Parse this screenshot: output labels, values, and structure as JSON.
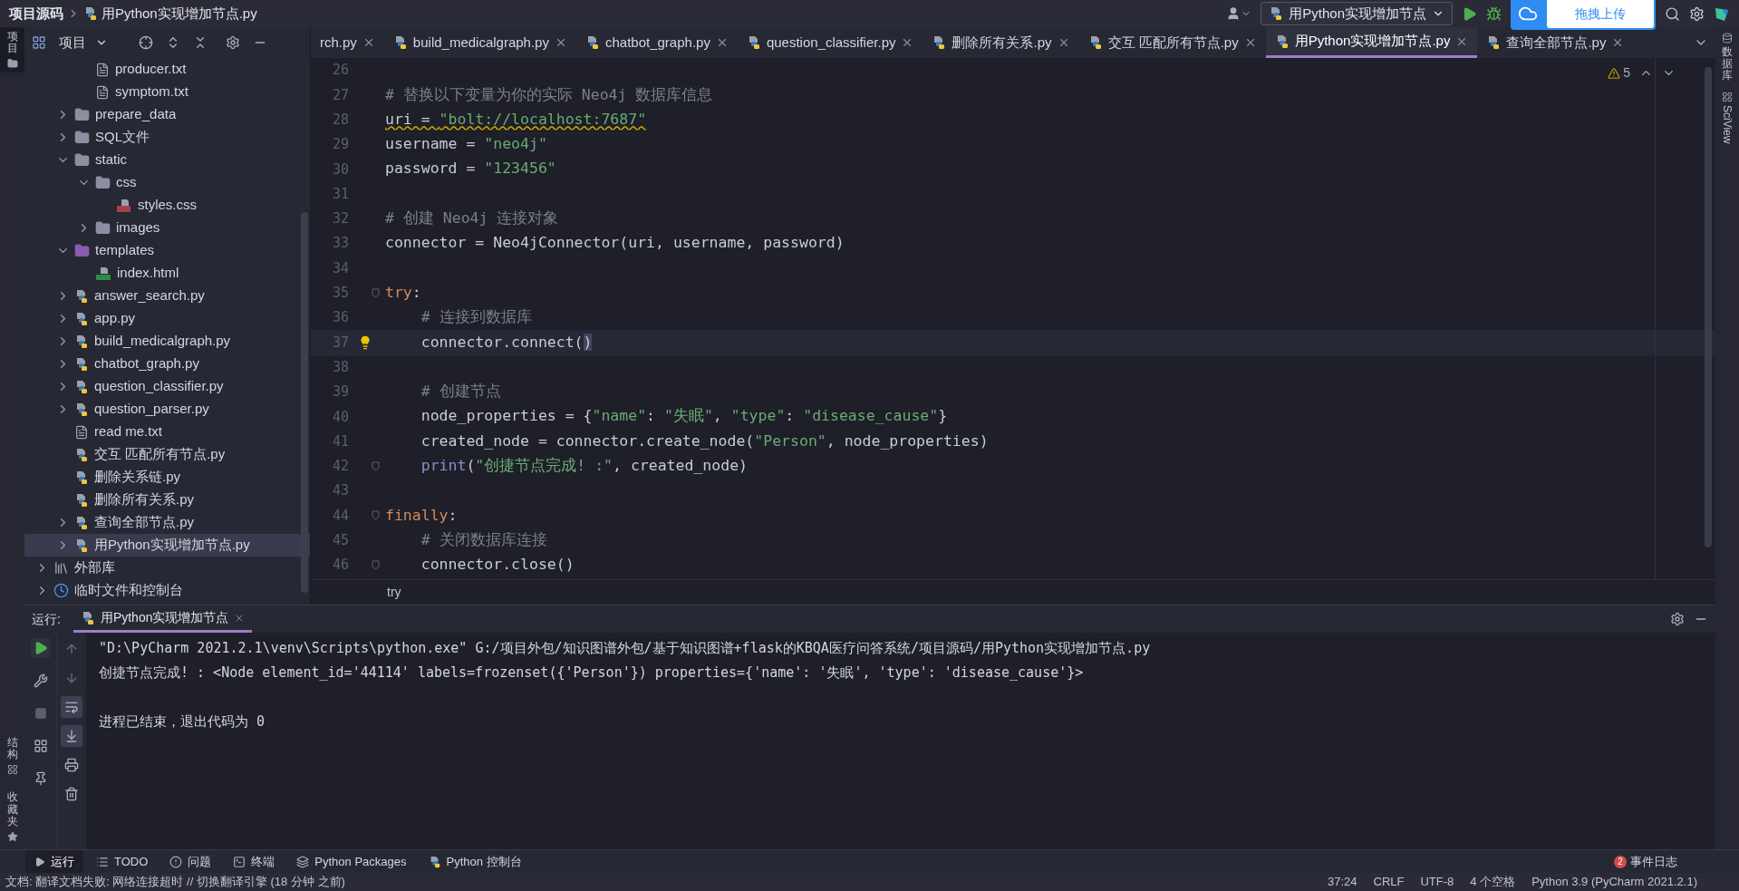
{
  "title_bar": {
    "breadcrumbs": [
      "项目源码",
      "用Python实现增加节点.py"
    ],
    "run_config": "用Python实现增加节点",
    "upload_popup": "拖拽上传"
  },
  "left_stripe": {
    "top": "项目",
    "bottom": [
      "结构",
      "收藏夹"
    ]
  },
  "right_stripe": {
    "items": [
      "数据库",
      "SciView"
    ]
  },
  "project_panel": {
    "title": "项目"
  },
  "tree": {
    "items": [
      {
        "children": [
          {
            "children": [
              {
                "label": "producer.txt",
                "kind": "text",
                "selected": false
              },
              {
                "label": "symptom.txt",
                "kind": "text",
                "selected": false
              }
            ]
          },
          {
            "label": "prepare_data",
            "kind": "folder",
            "expanded": false,
            "selected": false
          },
          {
            "label": "SQL文件",
            "kind": "folder",
            "expanded": false,
            "selected": false
          },
          {
            "label": "static",
            "kind": "folder",
            "expanded": true,
            "selected": false,
            "children": [
              {
                "label": "css",
                "kind": "folder",
                "expanded": true,
                "selected": false,
                "children": [
                  {
                    "label": "styles.css",
                    "kind": "css",
                    "selected": false
                  }
                ]
              },
              {
                "label": "images",
                "kind": "folder",
                "expanded": false,
                "selected": false
              }
            ]
          },
          {
            "label": "templates",
            "kind": "template_folder",
            "expanded": true,
            "selected": false,
            "children": [
              {
                "label": "index.html",
                "kind": "html",
                "selected": false
              }
            ]
          },
          {
            "label": "answer_search.py",
            "kind": "python",
            "expanded": false,
            "selected": false
          },
          {
            "label": "app.py",
            "kind": "python",
            "expanded": false,
            "selected": false
          },
          {
            "label": "build_medicalgraph.py",
            "kind": "python",
            "expanded": false,
            "selected": false
          },
          {
            "label": "chatbot_graph.py",
            "kind": "python",
            "expanded": false,
            "selected": false
          },
          {
            "label": "question_classifier.py",
            "kind": "python",
            "expanded": false,
            "selected": false
          },
          {
            "label": "question_parser.py",
            "kind": "python",
            "expanded": false,
            "selected": false
          },
          {
            "label": "read me.txt",
            "kind": "text",
            "selected": false
          },
          {
            "label": "交互 匹配所有节点.py",
            "kind": "python",
            "selected": false
          },
          {
            "label": "删除关系链.py",
            "kind": "python",
            "selected": false
          },
          {
            "label": "删除所有关系.py",
            "kind": "python",
            "selected": false
          },
          {
            "label": "查询全部节点.py",
            "kind": "python",
            "expanded": false,
            "selected": false
          },
          {
            "label": "用Python实现增加节点.py",
            "kind": "python",
            "expanded": false,
            "selected": true
          }
        ]
      },
      {
        "label": "外部库",
        "kind": "library",
        "expanded": false,
        "selected": false
      },
      {
        "label": "临时文件和控制台",
        "kind": "scratch",
        "expanded": false,
        "selected": false
      }
    ]
  },
  "tabs": [
    {
      "label": "rch.py",
      "selected": false
    },
    {
      "label": "build_medicalgraph.py",
      "selected": false
    },
    {
      "label": "chatbot_graph.py",
      "selected": false
    },
    {
      "label": "question_classifier.py",
      "selected": false
    },
    {
      "label": "删除所有关系.py",
      "selected": false
    },
    {
      "label": "交互 匹配所有节点.py",
      "selected": false
    },
    {
      "label": "用Python实现增加节点.py",
      "selected": true
    },
    {
      "label": "查询全部节点.py",
      "selected": false
    }
  ],
  "editor": {
    "warnings": "5",
    "breadcrumb": "try",
    "lines": [
      {
        "number": "26"
      },
      {
        "number": "27",
        "segments": [
          {
            "t": "# 替换以下变量为你的实际 Neo4j 数据库信息",
            "kind": "comment"
          }
        ]
      },
      {
        "number": "28",
        "segments": [
          {
            "t": "uri = ",
            "kind": "plain",
            "warn": true
          },
          {
            "t": "\"bolt://localhost:7687\"",
            "kind": "string",
            "warn": true
          }
        ]
      },
      {
        "number": "29",
        "segments": [
          {
            "t": "username = ",
            "kind": "plain"
          },
          {
            "t": "\"neo4j\"",
            "kind": "string"
          }
        ]
      },
      {
        "number": "30",
        "segments": [
          {
            "t": "password = ",
            "kind": "plain"
          },
          {
            "t": "\"123456\"",
            "kind": "string"
          }
        ]
      },
      {
        "number": "31"
      },
      {
        "number": "32",
        "segments": [
          {
            "t": "# 创建 Neo4j 连接对象",
            "kind": "comment"
          }
        ]
      },
      {
        "number": "33",
        "segments": [
          {
            "t": "connector = Neo4jConnector(uri, username, password)",
            "kind": "plain"
          }
        ]
      },
      {
        "number": "34"
      },
      {
        "number": "35",
        "fold": true,
        "segments": [
          {
            "t": "try",
            "kind": "keyword"
          },
          {
            "t": ":",
            "kind": "plain"
          }
        ]
      },
      {
        "number": "36",
        "segments": [
          {
            "t": "    # 连接到数据库",
            "kind": "comment"
          }
        ]
      },
      {
        "number": "37",
        "current": true,
        "bulb": true,
        "segments": [
          {
            "t": "    connector.connect(",
            "kind": "plain"
          },
          {
            "t": ")",
            "kind": "match"
          }
        ]
      },
      {
        "number": "38"
      },
      {
        "number": "39",
        "segments": [
          {
            "t": "    # 创建节点",
            "kind": "comment"
          }
        ]
      },
      {
        "number": "40",
        "segments": [
          {
            "t": "    node_properties = {",
            "kind": "plain"
          },
          {
            "t": "\"name\"",
            "kind": "string"
          },
          {
            "t": ": ",
            "kind": "plain"
          },
          {
            "t": "\"失眠\"",
            "kind": "string"
          },
          {
            "t": ", ",
            "kind": "plain"
          },
          {
            "t": "\"type\"",
            "kind": "string"
          },
          {
            "t": ": ",
            "kind": "plain"
          },
          {
            "t": "\"disease_cause\"",
            "kind": "string"
          },
          {
            "t": "}",
            "kind": "plain"
          }
        ]
      },
      {
        "number": "41",
        "segments": [
          {
            "t": "    created_node = connector.create_node(",
            "kind": "plain"
          },
          {
            "t": "\"Person\"",
            "kind": "string"
          },
          {
            "t": ", node_properties)",
            "kind": "plain"
          }
        ]
      },
      {
        "number": "42",
        "fold": true,
        "segments": [
          {
            "t": "    print",
            "kind": "builtin"
          },
          {
            "t": "(",
            "kind": "plain"
          },
          {
            "t": "\"创捷节点完成! :\"",
            "kind": "string"
          },
          {
            "t": ", created_node)",
            "kind": "plain"
          }
        ]
      },
      {
        "number": "43"
      },
      {
        "number": "44",
        "fold": true,
        "segments": [
          {
            "t": "finally",
            "kind": "keyword"
          },
          {
            "t": ":",
            "kind": "plain"
          }
        ]
      },
      {
        "number": "45",
        "segments": [
          {
            "t": "    # 关闭数据库连接",
            "kind": "comment"
          }
        ]
      },
      {
        "number": "46",
        "fold": true,
        "segments": [
          {
            "t": "    connector.close()",
            "kind": "plain"
          }
        ]
      }
    ]
  },
  "run_panel": {
    "label": "运行:",
    "tab": "用Python实现增加节点",
    "toolbar_left": [
      {
        "kind": "run",
        "disabled": false
      },
      {
        "kind": "wrench",
        "disabled": false
      },
      {
        "kind": "stop",
        "disabled": true
      },
      {
        "kind": "layout",
        "disabled": false
      },
      {
        "kind": "pin",
        "disabled": false
      }
    ],
    "toolbar_right": [
      {
        "kind": "up",
        "selected": false
      },
      {
        "kind": "down",
        "selected": false
      },
      {
        "kind": "wrap",
        "selected": true
      },
      {
        "kind": "scroll",
        "selected": true
      },
      {
        "kind": "print",
        "selected": false
      },
      {
        "kind": "trash",
        "selected": false
      }
    ],
    "console": [
      "\"D:\\PyCharm 2021.2.1\\venv\\Scripts\\python.exe\" G:/项目外包/知识图谱外包/基于知识图谱+flask的KBQA医疗问答系统/项目源码/用Python实现增加节点.py",
      "创捷节点完成! : <Node element_id='44114' labels=frozenset({'Person'}) properties={'name': '失眠', 'type': 'disease_cause'}>",
      "进程已结束，退出代码为 0"
    ]
  },
  "bottom_tabs": [
    {
      "label": "运行",
      "kind": "run",
      "selected": true
    },
    {
      "label": "TODO",
      "kind": "list",
      "selected": false
    },
    {
      "label": "问题",
      "kind": "problems",
      "selected": false
    },
    {
      "label": "终端",
      "kind": "terminal",
      "selected": false
    },
    {
      "label": "Python Packages",
      "kind": "packages",
      "selected": false
    },
    {
      "label": "Python 控制台",
      "kind": "python",
      "selected": false
    }
  ],
  "event_log": {
    "label": "事件日志",
    "badge": "2"
  },
  "status_bar": {
    "message": "文档: 翻译文档失败: 网络连接超时 // 切换翻译引擎 (18 分钟 之前)",
    "items": [
      "37:24",
      "CRLF",
      "UTF-8",
      "4 个空格",
      "Python 3.9 (PyCharm 2021.2.1)"
    ]
  }
}
